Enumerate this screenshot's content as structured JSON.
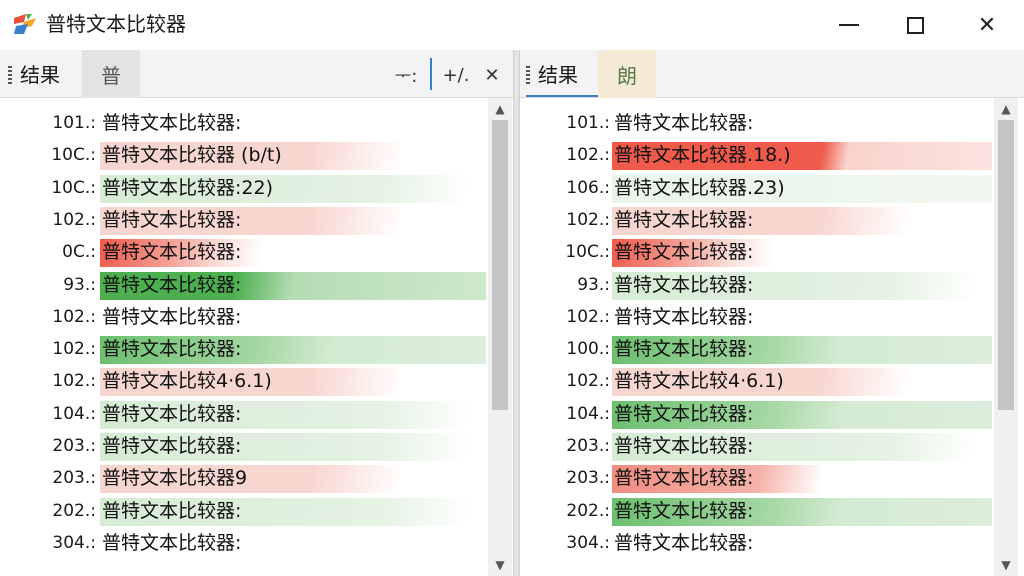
{
  "window": {
    "title": "普特文本比较器",
    "minimize_label": "",
    "maximize_label": "",
    "close_label": "✕"
  },
  "colors": {
    "red_strong": "#ef5a4a",
    "red_light": "#f8d6d0",
    "green_strong": "#4caf50",
    "green_light": "#d6ecd4",
    "blue_accent": "#3c7fd1"
  },
  "left": {
    "tab_label": "结果",
    "tab2_label": "普",
    "tools": [
      {
        "name": "filter-icon",
        "glyph": "ᅮ:"
      },
      {
        "name": "sort-icon",
        "glyph": "+∕."
      },
      {
        "name": "close-icon",
        "glyph": "✕"
      }
    ],
    "rows": [
      {
        "num": "101.:",
        "text": "普特文本比较器:",
        "hl": "none"
      },
      {
        "num": "10C.:",
        "text": "普特文本比较器 (b/t)",
        "hl": "red_light"
      },
      {
        "num": "10C.:",
        "text": "普特文本比较器:22)",
        "hl": "green_light"
      },
      {
        "num": "102.:",
        "text": "普特文本比较器:",
        "hl": "red_light"
      },
      {
        "num": "0C.:",
        "text": "普特文本比较器:",
        "hl": "red_strong_short"
      },
      {
        "num": "93.:",
        "text": "普特文本比较器:",
        "hl": "green_strong"
      },
      {
        "num": "102.:",
        "text": "普特文本比较器:",
        "hl": "none"
      },
      {
        "num": "102.:",
        "text": "普特文本比较器:",
        "hl": "green_mid"
      },
      {
        "num": "102.:",
        "text": "普特文本比较4·6.1)",
        "hl": "red_light"
      },
      {
        "num": "104.:",
        "text": "普特文本比较器:",
        "hl": "green_light"
      },
      {
        "num": "203.:",
        "text": "普特文本比较器:",
        "hl": "green_light"
      },
      {
        "num": "203.:",
        "text": "普特文本比较器9",
        "hl": "red_light"
      },
      {
        "num": "202.:",
        "text": "普特文本比较器:",
        "hl": "green_light"
      },
      {
        "num": "304.:",
        "text": "普特文本比较器:",
        "hl": "none"
      }
    ]
  },
  "right": {
    "tab_label": "结果",
    "tab2_label": "朗",
    "rows": [
      {
        "num": "101.:",
        "text": "普特文本比较器:",
        "hl": "none"
      },
      {
        "num": "102.:",
        "text": "普特文本比较器.18.)",
        "hl": "red_strong"
      },
      {
        "num": "106.:",
        "text": "普特文本比较器.23)",
        "hl": "green_faint"
      },
      {
        "num": "102.:",
        "text": "普特文本比较器:",
        "hl": "red_light"
      },
      {
        "num": "10C.:",
        "text": "普特文本比较器:",
        "hl": "red_strong_short"
      },
      {
        "num": "93.:",
        "text": "普特文本比较器:",
        "hl": "green_light"
      },
      {
        "num": "102.:",
        "text": "普特文本比较器:",
        "hl": "none"
      },
      {
        "num": "100.:",
        "text": "普特文本比较器:",
        "hl": "green_mid"
      },
      {
        "num": "102.:",
        "text": "普特文本比较4·6.1)",
        "hl": "red_light"
      },
      {
        "num": "104.:",
        "text": "普特文本比较器:",
        "hl": "green_mid"
      },
      {
        "num": "203.:",
        "text": "普特文本比较器:",
        "hl": "green_light"
      },
      {
        "num": "203.:",
        "text": "普特文本比较器:",
        "hl": "red_mid"
      },
      {
        "num": "202.:",
        "text": "普特文本比较器:",
        "hl": "green_mid"
      },
      {
        "num": "304.:",
        "text": "普特文本比较器:",
        "hl": "none"
      }
    ]
  }
}
